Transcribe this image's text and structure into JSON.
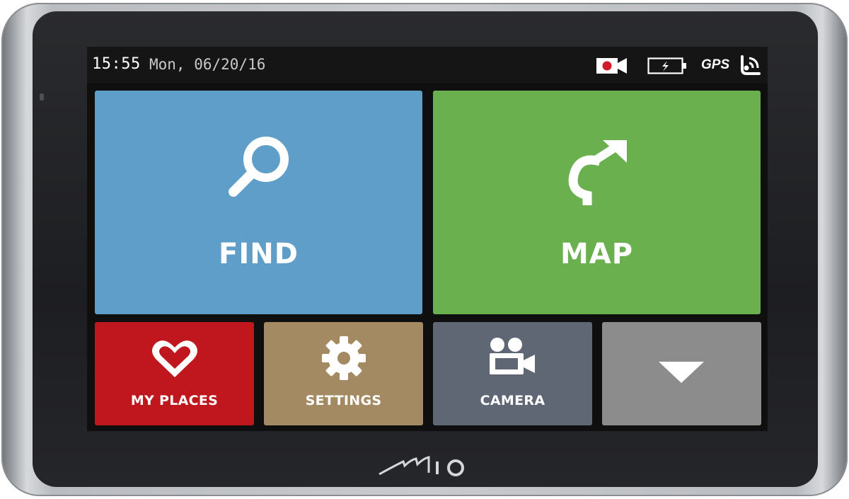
{
  "device": {
    "brand_logo": "Mio"
  },
  "status_bar": {
    "time": "15:55",
    "date": "Mon, 06/20/16",
    "icons": [
      "camera-recording-icon",
      "battery-charging-icon",
      "gps-signal-icon"
    ],
    "gps_label": "GPS"
  },
  "main_menu": {
    "tiles": [
      {
        "label": "FIND",
        "icon": "search-icon",
        "color": "#5f9ec8"
      },
      {
        "label": "MAP",
        "icon": "turn-arrow-icon",
        "color": "#6ab04f"
      },
      {
        "label": "MY PLACES",
        "icon": "heart-icon",
        "color": "#c0161e"
      },
      {
        "label": "SETTINGS",
        "icon": "gear-icon",
        "color": "#a38a62"
      },
      {
        "label": "CAMERA",
        "icon": "video-camera-icon",
        "color": "#5f6775"
      },
      {
        "label": "",
        "icon": "chevron-down-icon",
        "color": "#8c8c8c"
      }
    ]
  },
  "colors": {
    "bezel": "#1f2023",
    "frame": "#c8cacd",
    "screen_background": "#0f0f10",
    "recording_red": "#d21b2b"
  }
}
